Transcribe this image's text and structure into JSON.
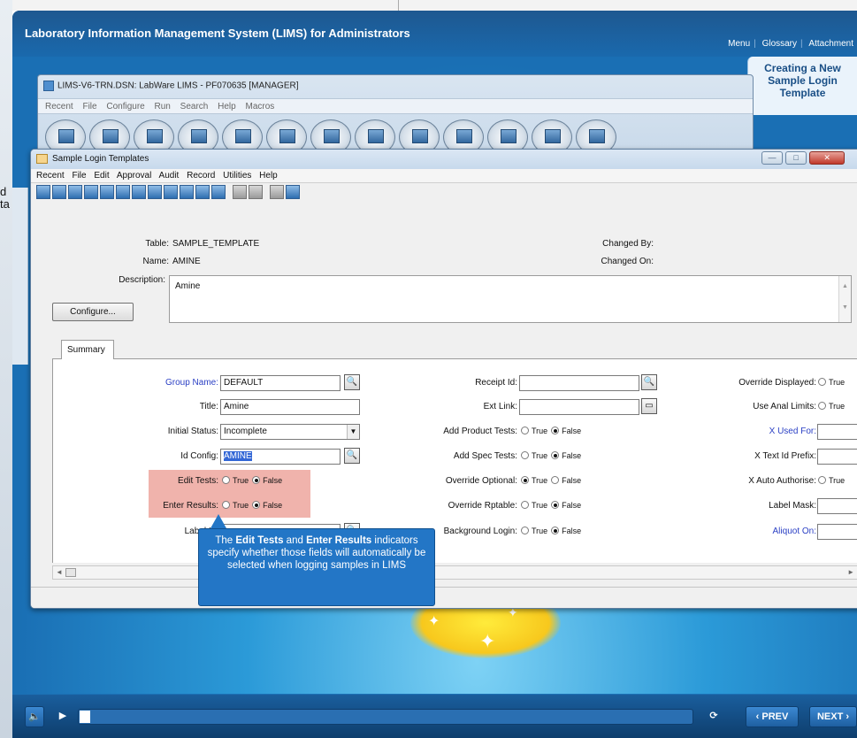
{
  "course": {
    "title": "Laboratory Information Management System (LIMS) for Administrators",
    "links": [
      "Menu",
      "Glossary",
      "Attachment"
    ],
    "topic": "Creating a New Sample Login Template",
    "left_peek": "d\nta"
  },
  "main_window": {
    "title": "LIMS-V6-TRN.DSN: LabWare LIMS - PF070635 [MANAGER]",
    "menu": [
      "Recent",
      "File",
      "Configure",
      "Run",
      "Search",
      "Help",
      "Macros"
    ],
    "toolbar_button_count": 13
  },
  "slt_window": {
    "title": "Sample Login Templates",
    "menu": [
      "Recent",
      "File",
      "Edit",
      "Approval",
      "Audit",
      "Record",
      "Utilities",
      "Help"
    ],
    "header": {
      "table_label": "Table:",
      "table_value": "SAMPLE_TEMPLATE",
      "name_label": "Name:",
      "name_value": "AMINE",
      "description_label": "Description:",
      "description_value": "Amine",
      "changed_by_label": "Changed By:",
      "changed_on_label": "Changed On:",
      "configure_label": "Configure..."
    },
    "tab": "Summary",
    "fields": {
      "group_name_label": "Group Name:",
      "group_name_value": "DEFAULT",
      "title_label": "Title:",
      "title_value": "Amine",
      "initial_status_label": "Initial Status:",
      "initial_status_value": "Incomplete",
      "id_config_label": "Id Config:",
      "id_config_value": "AMINE",
      "edit_tests_label": "Edit Tests:",
      "enter_results_label": "Enter Results:",
      "label_id_label": "Label Id:",
      "receipt_id_label": "Receipt Id:",
      "ext_link_label": "Ext Link:",
      "add_product_tests_label": "Add Product Tests:",
      "add_spec_tests_label": "Add Spec Tests:",
      "override_optional_label": "Override Optional:",
      "override_rptable_label": "Override Rptable:",
      "background_login_label": "Background Login:",
      "override_displayed_label": "Override Displayed:",
      "use_anal_limits_label": "Use Anal Limits:",
      "x_used_for_label": "X Used For:",
      "x_text_id_prefix_label": "X Text Id Prefix:",
      "x_auto_authorise_label": "X Auto Authorise:",
      "label_mask_label": "Label Mask:",
      "aliquot_on_label": "Aliquot On:",
      "true_label": "True",
      "false_label": "False"
    }
  },
  "callout": {
    "part1": "The ",
    "bold1": "Edit Tests",
    "part2": " and ",
    "bold2": "Enter Results",
    "part3": " indicators specify whether those fields will automatically be selected when logging samples in LIMS"
  },
  "player": {
    "prev_label": "‹ PREV",
    "next_label": "NEXT ›",
    "progress": 0.01
  }
}
